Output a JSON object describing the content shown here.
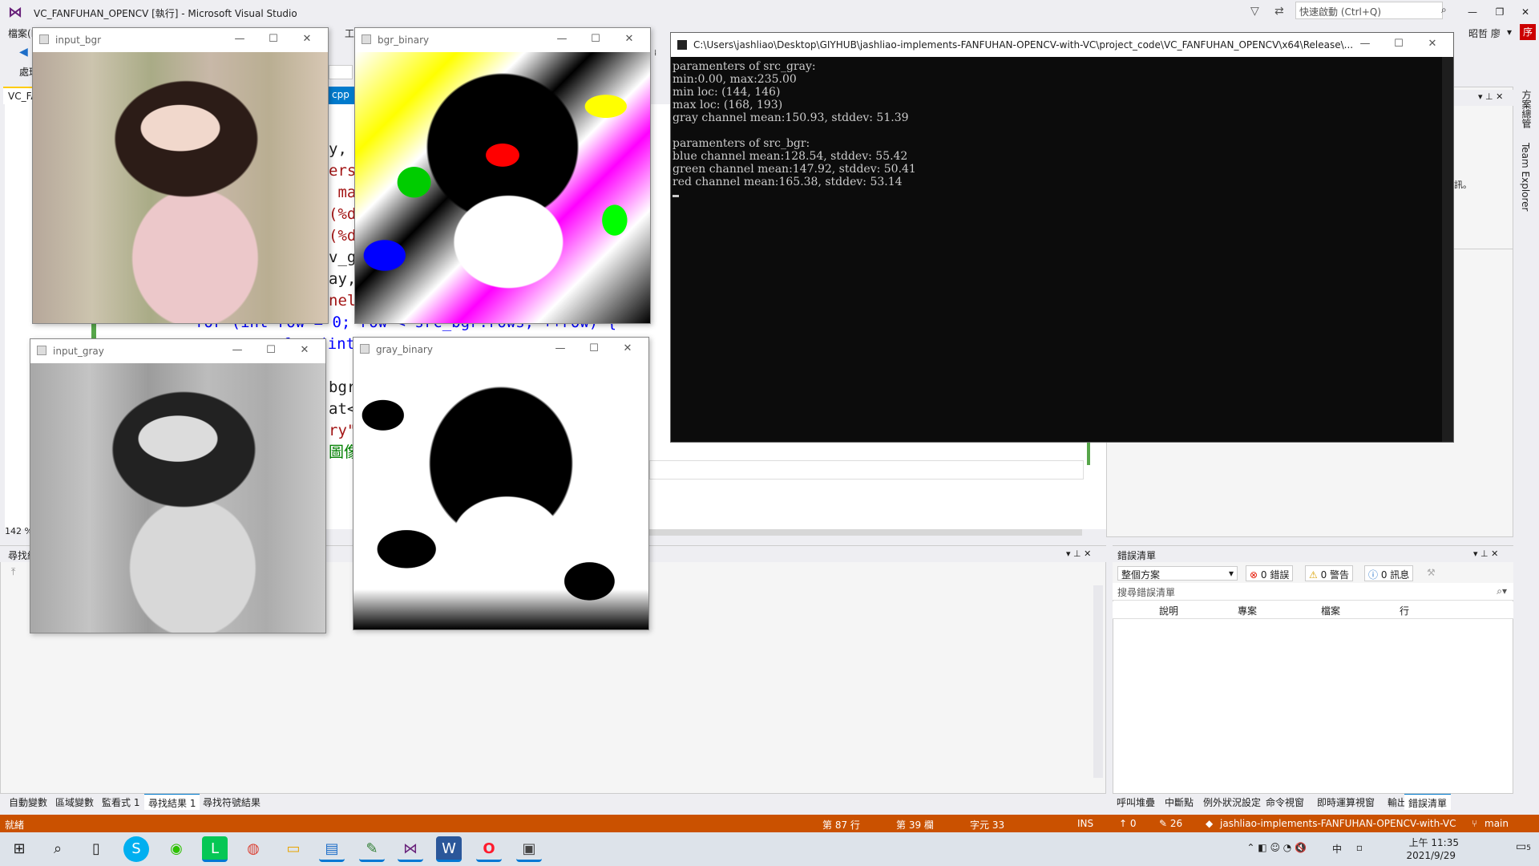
{
  "vs": {
    "title": "VC_FANFUHAN_OPENCV [執行] - Microsoft Visual Studio",
    "quick_launch": "快速啟動 (Ctrl+Q)",
    "user": "昭哲 廖",
    "menu_file": "檔案(F)",
    "menu_tools": "工",
    "toolbar_proc": "處理",
    "doc_tab_1": "VC_FA",
    "doc_tab_2": "VC",
    "doc_tab_cpp": "cpp",
    "zoom": "142 %",
    "side_tab_1": "方案總管",
    "side_tab_2": "Team Explorer",
    "sol_hint": "訊。"
  },
  "code_lines": [
    "y, /",
    "ers",
    " max",
    "(%d,",
    "(%d,",
    "",
    "v_g",
    "ay,",
    "nel",
    "  for (int row = 0; row < src_bgr.rows; ++row) {",
    "        for (int col = 0",
    "     = ",
    "bgr",
    "at<",
    "",
    "",
    "ry\"",
    "",
    "圖像"
  ],
  "windows": {
    "input_bgr": "input_bgr",
    "bgr_binary": "bgr_binary",
    "input_gray": "input_gray",
    "gray_binary": "gray_binary"
  },
  "console": {
    "title": "C:\\Users\\jashliao\\Desktop\\GIYHUB\\jashliao-implements-FANFUHAN-OPENCV-with-VC\\project_code\\VC_FANFUHAN_OPENCV\\x64\\Release\\...",
    "lines": "paramenters of src_gray:\nmin:0.00, max:235.00\nmin loc: (144, 146)\nmax loc: (168, 193)\ngray channel mean:150.93, stddev: 51.39\n\nparamenters of src_bgr:\nblue channel mean:128.54, stddev: 55.42\ngreen channel mean:147.92, stddev: 50.41\nred channel mean:165.38, stddev: 53.14"
  },
  "find_panel": {
    "header": "尋找結"
  },
  "bottom_tabs_left": [
    "自動變數",
    "區域變數",
    "監看式 1",
    "尋找結果 1",
    "尋找符號結果"
  ],
  "error_list": {
    "header": "錯誤清單",
    "scope": "整個方案",
    "errors": "0 錯誤",
    "warnings": "0 警告",
    "messages": "0 訊息",
    "search": "搜尋錯誤清單",
    "col_desc": "說明",
    "col_project": "專案",
    "col_file": "檔案",
    "col_line": "行"
  },
  "bottom_tabs_right": [
    "呼叫堆疊",
    "中斷點",
    "例外狀況設定",
    "命令視窗",
    "即時運算視窗",
    "輸出",
    "錯誤清單"
  ],
  "status": {
    "ready": "就緒",
    "line": "第 87 行",
    "col": "第 39 欄",
    "char": "字元 33",
    "ins": "INS",
    "up": "↑ 0",
    "edits": "✎ 26",
    "repo": "jashliao-implements-FANFUHAN-OPENCV-with-VC",
    "branch": "main"
  },
  "taskbar": {
    "time": "上午 11:35",
    "date": "2021/9/29",
    "ime": "中",
    "notif": "5"
  },
  "colors": {
    "status_bar": "#ca5100",
    "console_bg": "#0c0c0c"
  }
}
